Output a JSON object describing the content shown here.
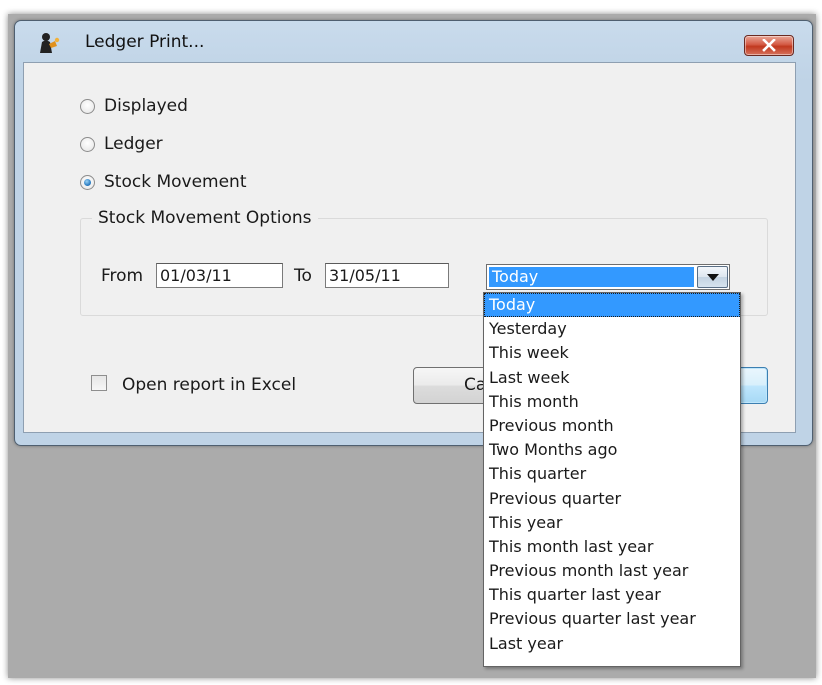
{
  "window": {
    "title": "Ledger Print..."
  },
  "radios": [
    {
      "label": "Displayed",
      "checked": false
    },
    {
      "label": "Ledger",
      "checked": false
    },
    {
      "label": "Stock Movement",
      "checked": true
    }
  ],
  "options": {
    "group_label": "Stock Movement Options",
    "from_label": "From",
    "from_value": "01/03/11",
    "to_label": "To",
    "to_value": "31/05/11",
    "period_selected": "Today"
  },
  "excel": {
    "label": "Open report in Excel",
    "checked": false
  },
  "buttons": {
    "cancel_visible": "Ca",
    "ok_label": ""
  },
  "dropdown": {
    "items": [
      "Today",
      "Yesterday",
      "This week",
      "Last week",
      "This month",
      "Previous month",
      "Two Months ago",
      "This quarter",
      "Previous quarter",
      "This year",
      "This month last year",
      "Previous month last year",
      "This quarter last year",
      "Previous quarter last year",
      "Last year"
    ],
    "selected_index": 0
  },
  "colors": {
    "selection": "#3399ff",
    "close_button": "#c1381e",
    "title_bar": "#c9dbec"
  }
}
